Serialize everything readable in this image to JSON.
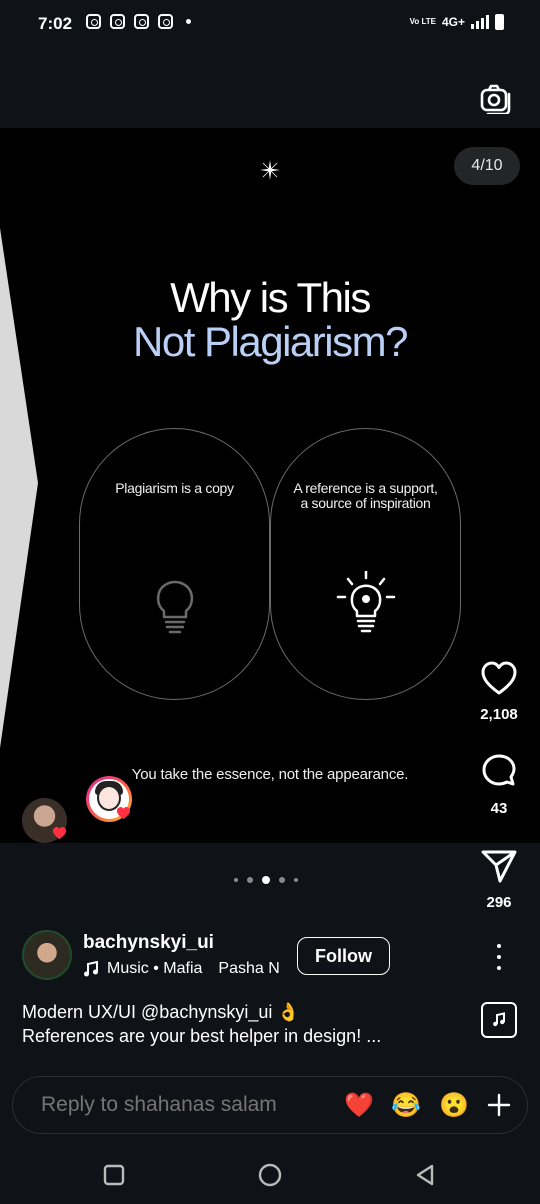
{
  "status_bar": {
    "time": "7:02",
    "network": "4G+",
    "volte": "Vo LTE"
  },
  "post": {
    "counter": "4/10",
    "headline_line1": "Why is This",
    "headline_line2": "Not Plagiarism?",
    "left_card_text": "Plagiarism is a copy",
    "right_card_text": "A reference is a support, a source of inspiration",
    "bottom_line": "You take the essence, not the appearance."
  },
  "actions": {
    "likes": "2,108",
    "comments": "43",
    "shares": "296"
  },
  "carousel": {
    "total_dots": 5,
    "active_index": 2
  },
  "author": {
    "username": "bachynskyi_ui",
    "music": "Music • Mafia",
    "music_extra": "Pasha N",
    "follow_label": "Follow"
  },
  "caption": {
    "line1": "Modern UX/UI @bachynskyi_ui 👌",
    "line2": "References are your best helper in design! ..."
  },
  "reply": {
    "placeholder": "Reply to shahanas salam",
    "emojis": [
      "❤️",
      "😂",
      "😮"
    ]
  },
  "colors": {
    "headline_accent": "#b9cff5",
    "like_badge": "#ff3040",
    "background": "#000000"
  },
  "icons": [
    "camera-icon",
    "sparkle-icon",
    "bulb-off-icon",
    "bulb-on-icon",
    "heart-icon",
    "comment-icon",
    "share-icon",
    "music-note-icon",
    "more-icon",
    "plus-icon"
  ]
}
